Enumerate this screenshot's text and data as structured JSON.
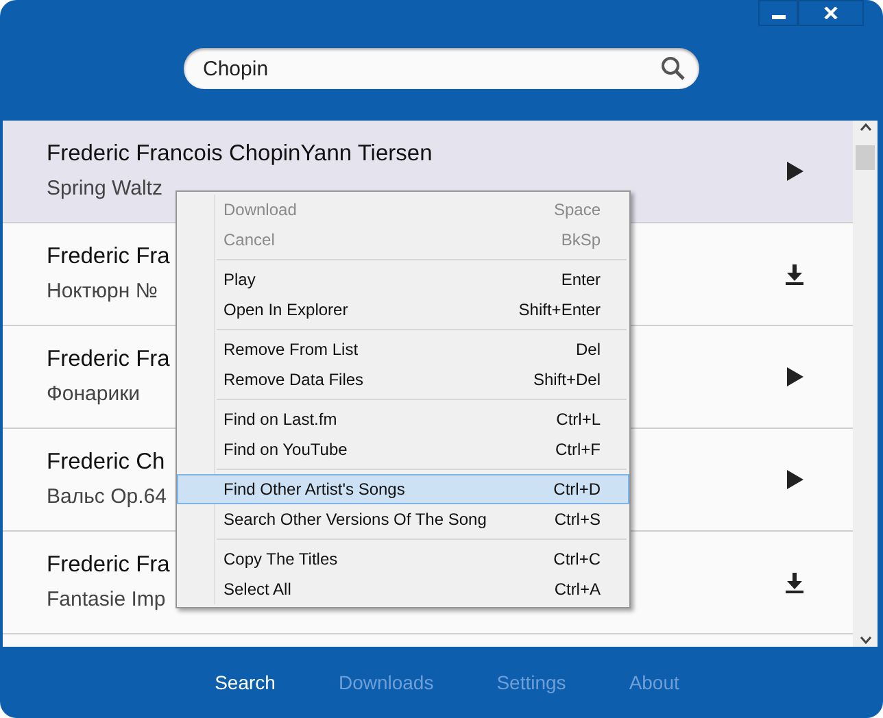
{
  "search": {
    "value": "Chopin"
  },
  "tracks": [
    {
      "title": "Frederic Francois ChopinYann Tiersen",
      "subtitle": "Spring Waltz",
      "selected": true,
      "kind": "play"
    },
    {
      "title": "Frederic Fra",
      "subtitle": "Ноктюрн №",
      "selected": false,
      "kind": "download"
    },
    {
      "title": "Frederic Fra",
      "subtitle": "Фонарики",
      "selected": false,
      "kind": "play"
    },
    {
      "title": "Frederic Ch",
      "subtitle": "Вальс Op.64",
      "selected": false,
      "kind": "play"
    },
    {
      "title": "Frederic Fra",
      "subtitle": "Fantasie Imp",
      "selected": false,
      "kind": "download"
    }
  ],
  "context_menu": {
    "groups": [
      [
        {
          "label": "Download",
          "shortcut": "Space",
          "disabled": true,
          "selected": false
        },
        {
          "label": "Cancel",
          "shortcut": "BkSp",
          "disabled": true,
          "selected": false
        }
      ],
      [
        {
          "label": "Play",
          "shortcut": "Enter",
          "disabled": false,
          "selected": false
        },
        {
          "label": "Open In Explorer",
          "shortcut": "Shift+Enter",
          "disabled": false,
          "selected": false
        }
      ],
      [
        {
          "label": "Remove From List",
          "shortcut": "Del",
          "disabled": false,
          "selected": false
        },
        {
          "label": "Remove Data Files",
          "shortcut": "Shift+Del",
          "disabled": false,
          "selected": false
        }
      ],
      [
        {
          "label": "Find on Last.fm",
          "shortcut": "Ctrl+L",
          "disabled": false,
          "selected": false
        },
        {
          "label": "Find on YouTube",
          "shortcut": "Ctrl+F",
          "disabled": false,
          "selected": false
        }
      ],
      [
        {
          "label": "Find Other Artist's Songs",
          "shortcut": "Ctrl+D",
          "disabled": false,
          "selected": true
        },
        {
          "label": "Search Other Versions Of The Song",
          "shortcut": "Ctrl+S",
          "disabled": false,
          "selected": false
        }
      ],
      [
        {
          "label": "Copy The Titles",
          "shortcut": "Ctrl+C",
          "disabled": false,
          "selected": false
        },
        {
          "label": "Select All",
          "shortcut": "Ctrl+A",
          "disabled": false,
          "selected": false
        }
      ]
    ]
  },
  "tabs": [
    {
      "label": "Search",
      "selected": true
    },
    {
      "label": "Downloads",
      "selected": false
    },
    {
      "label": "Settings",
      "selected": false
    },
    {
      "label": "About",
      "selected": false
    }
  ]
}
